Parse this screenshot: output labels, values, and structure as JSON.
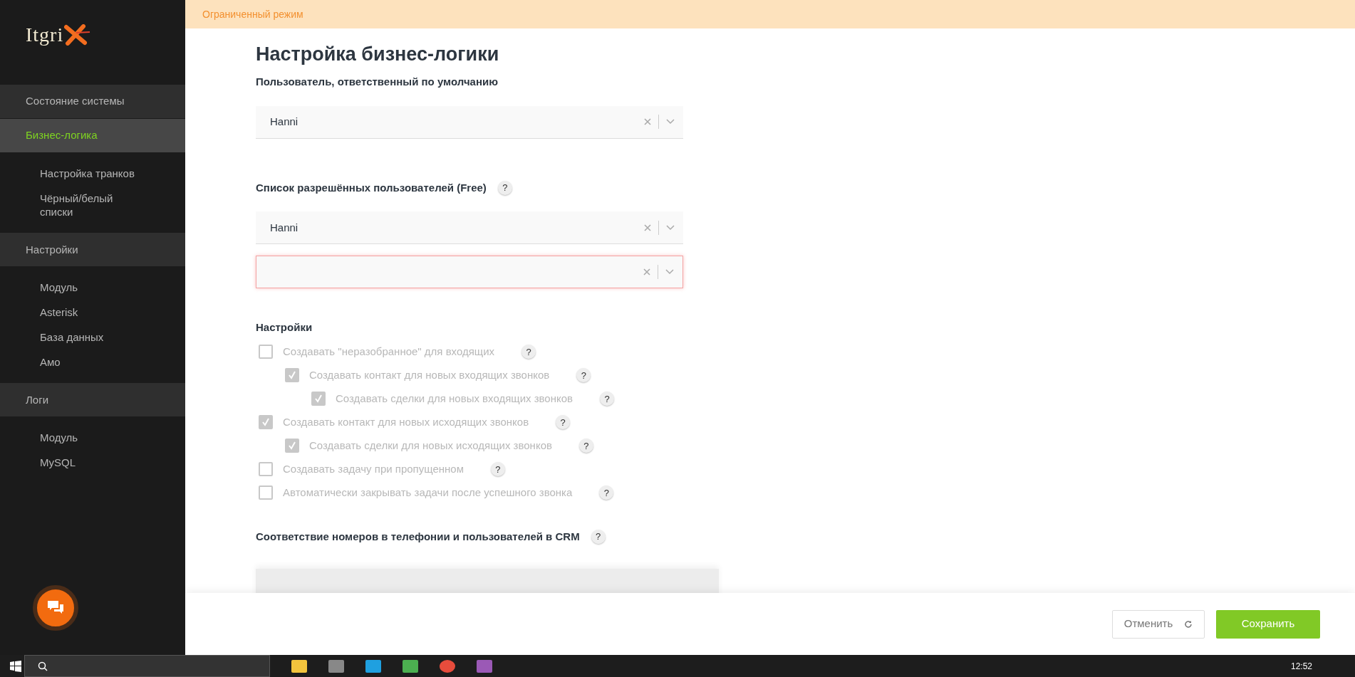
{
  "logo": {
    "text": "Itgri"
  },
  "sidebar": {
    "groups": [
      {
        "label": "Состояние системы",
        "selected": false
      },
      {
        "label": "Бизнес-логика",
        "selected": true,
        "items": [
          {
            "label": "Настройка транков",
            "selected": false
          },
          {
            "label": "Чёрный/белый списки",
            "selected": false
          }
        ]
      },
      {
        "label": "Настройки",
        "selected": false,
        "items": [
          {
            "label": "Модуль",
            "selected": false
          },
          {
            "label": "Asterisk",
            "selected": false
          },
          {
            "label": "База данных",
            "selected": false
          },
          {
            "label": "Амо",
            "selected": false
          }
        ]
      },
      {
        "label": "Логи",
        "selected": false,
        "items": [
          {
            "label": "Модуль",
            "selected": false
          },
          {
            "label": "MySQL",
            "selected": false
          }
        ]
      }
    ]
  },
  "banner": {
    "text": "Ограниченный режим"
  },
  "page_title": "Настройка бизнес-логики",
  "default_user": {
    "label": "Пользователь, ответственный по умолчанию",
    "select": {
      "value": "Hanni",
      "invalid": false
    }
  },
  "allowed_users": {
    "label": "Список разрешённых пользователей (Free)",
    "help": "?",
    "selects": [
      {
        "value": "Hanni",
        "invalid": false
      },
      {
        "invalid": true
      }
    ]
  },
  "settings": {
    "title": "Настройки",
    "options": [
      {
        "label": "Создавать \"неразобранное\" для входящих",
        "checked": false,
        "disabled": true,
        "help": "?",
        "children": [
          {
            "label": "Создавать контакт для новых входящих звонков",
            "checked": true,
            "disabled": true,
            "help": "?",
            "children": [
              {
                "label": "Создавать сделки для новых входящих звонков",
                "checked": true,
                "disabled": true,
                "help": "?"
              }
            ]
          }
        ]
      },
      {
        "label": "Создавать контакт для новых исходящих звонков",
        "checked": true,
        "disabled": true,
        "help": "?",
        "children": [
          {
            "label": "Создавать сделки для новых исходящих звонков",
            "checked": true,
            "disabled": true,
            "help": "?"
          }
        ]
      },
      {
        "label": "Создавать задачу при пропущенном",
        "checked": false,
        "disabled": true,
        "help": "?"
      },
      {
        "label": "Автоматически закрывать задачи после успешного звонка",
        "checked": false,
        "disabled": true,
        "help": "?"
      }
    ]
  },
  "mapping": {
    "title": "Соответствие номеров в телефонии и пользователей в CRM",
    "help": "?"
  },
  "footer": {
    "buttons": [
      {
        "label": "Отменить",
        "kind": "cancel"
      },
      {
        "label": "Сохранить",
        "kind": "save"
      }
    ]
  },
  "taskbar": {
    "clock": "12:52"
  }
}
